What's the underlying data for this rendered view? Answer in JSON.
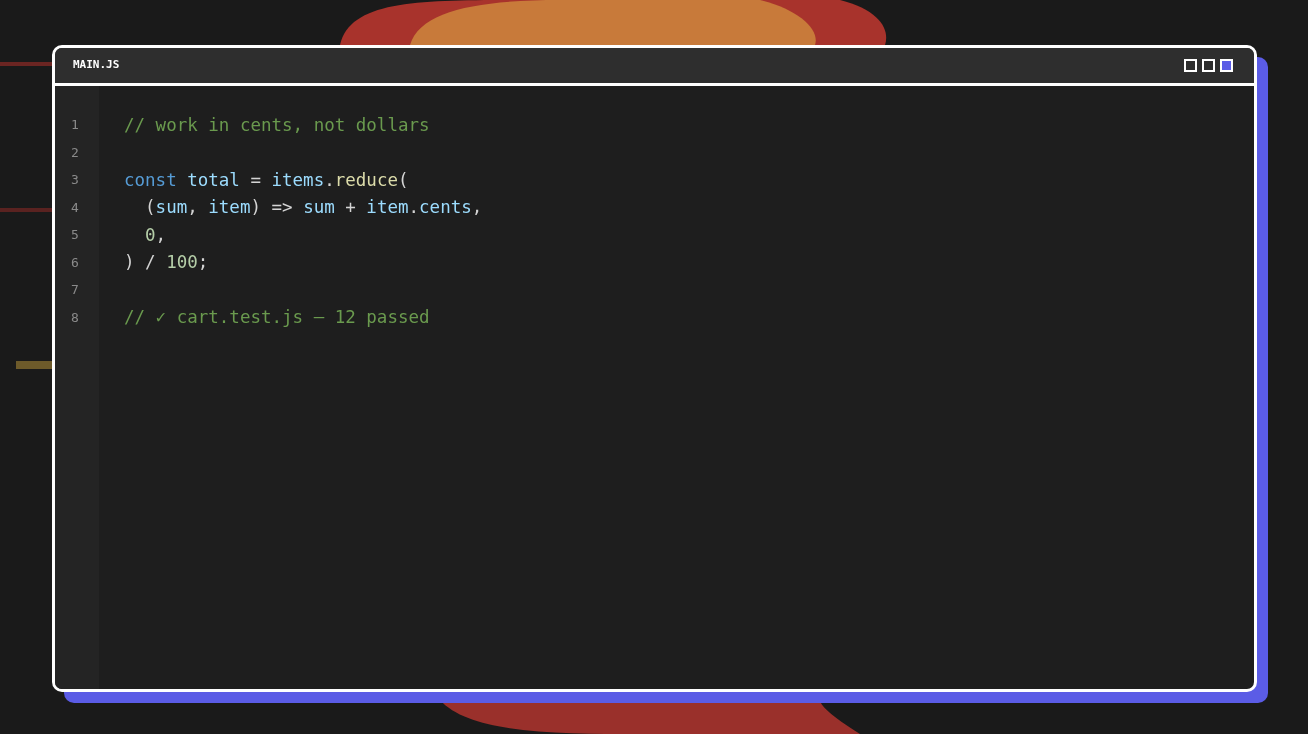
{
  "window": {
    "title": "MAIN.JS",
    "controls": [
      {
        "filled": false
      },
      {
        "filled": false
      },
      {
        "filled": true
      }
    ]
  },
  "editor": {
    "lines": [
      {
        "number": "1",
        "tokens": [
          {
            "text": "// work in cents, not dollars",
            "kind": "comment"
          }
        ]
      },
      {
        "number": "2"
      },
      {
        "number": "3",
        "tokens": [
          {
            "text": "const ",
            "kind": "keyword"
          },
          {
            "text": "total",
            "kind": "variable"
          },
          {
            "text": " = ",
            "kind": "punct"
          },
          {
            "text": "items",
            "kind": "variable"
          },
          {
            "text": ".",
            "kind": "punct"
          },
          {
            "text": "reduce",
            "kind": "function"
          },
          {
            "text": "(",
            "kind": "punct"
          }
        ]
      },
      {
        "number": "4",
        "tokens": [
          {
            "text": "  (",
            "kind": "punct"
          },
          {
            "text": "sum",
            "kind": "variable"
          },
          {
            "text": ", ",
            "kind": "punct"
          },
          {
            "text": "item",
            "kind": "variable"
          },
          {
            "text": ") => ",
            "kind": "punct"
          },
          {
            "text": "sum",
            "kind": "variable"
          },
          {
            "text": " + ",
            "kind": "punct"
          },
          {
            "text": "item",
            "kind": "variable"
          },
          {
            "text": ".",
            "kind": "punct"
          },
          {
            "text": "cents",
            "kind": "variable"
          },
          {
            "text": ",",
            "kind": "punct"
          }
        ]
      },
      {
        "number": "5",
        "tokens": [
          {
            "text": "  0",
            "kind": "number"
          },
          {
            "text": ",",
            "kind": "punct"
          }
        ]
      },
      {
        "number": "6",
        "tokens": [
          {
            "text": ") / ",
            "kind": "punct"
          },
          {
            "text": "100",
            "kind": "number"
          },
          {
            "text": ";",
            "kind": "punct"
          }
        ]
      },
      {
        "number": "7"
      },
      {
        "number": "8",
        "tokens": [
          {
            "text": "// ✓ cart.test.js — 12 passed",
            "kind": "comment"
          }
        ]
      }
    ]
  }
}
